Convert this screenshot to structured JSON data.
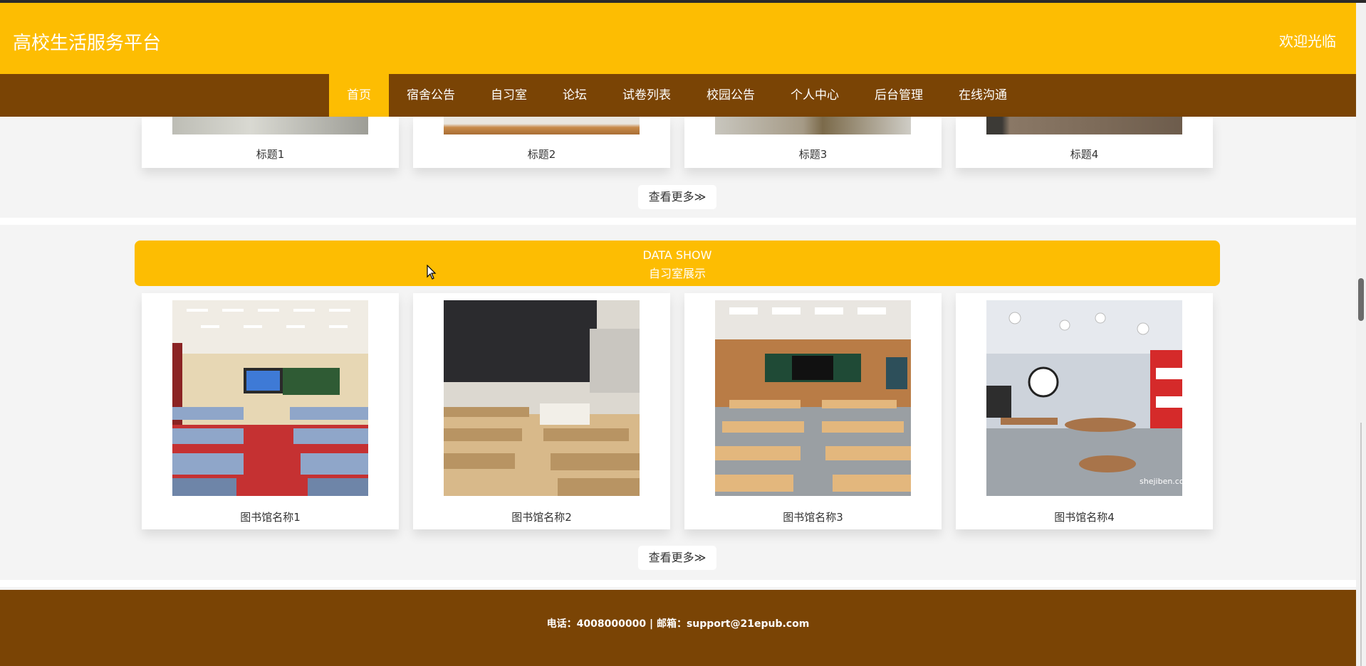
{
  "header": {
    "title": "高校生活服务平台",
    "welcome": "欢迎光临"
  },
  "nav": {
    "items": [
      "首页",
      "宿舍公告",
      "自习室",
      "论坛",
      "试卷列表",
      "校园公告",
      "个人中心",
      "后台管理",
      "在线沟通"
    ],
    "active": 0
  },
  "section_top": {
    "cards": [
      {
        "caption": "标题1"
      },
      {
        "caption": "标题2"
      },
      {
        "caption": "标题3"
      },
      {
        "caption": "标题4"
      }
    ],
    "more_label": "查看更多≫"
  },
  "data_show": {
    "title_en": "DATA SHOW",
    "title_cn": "自习室展示",
    "cards": [
      {
        "caption": "图书馆名称1",
        "image": "classroom-red-carpet"
      },
      {
        "caption": "图书馆名称2",
        "image": "classroom-blackboard"
      },
      {
        "caption": "图书馆名称3",
        "image": "classroom-wooden-desks"
      },
      {
        "caption": "图书馆名称4",
        "image": "classroom-round-tables"
      }
    ],
    "watermark": "shejiben.co",
    "more_label": "查看更多≫"
  },
  "footer": {
    "text": "电话：4008000000 | 邮箱：support@21epub.com"
  },
  "colors": {
    "primary": "#fdbd02",
    "nav": "#7a4405",
    "background": "#f4f4f4"
  }
}
